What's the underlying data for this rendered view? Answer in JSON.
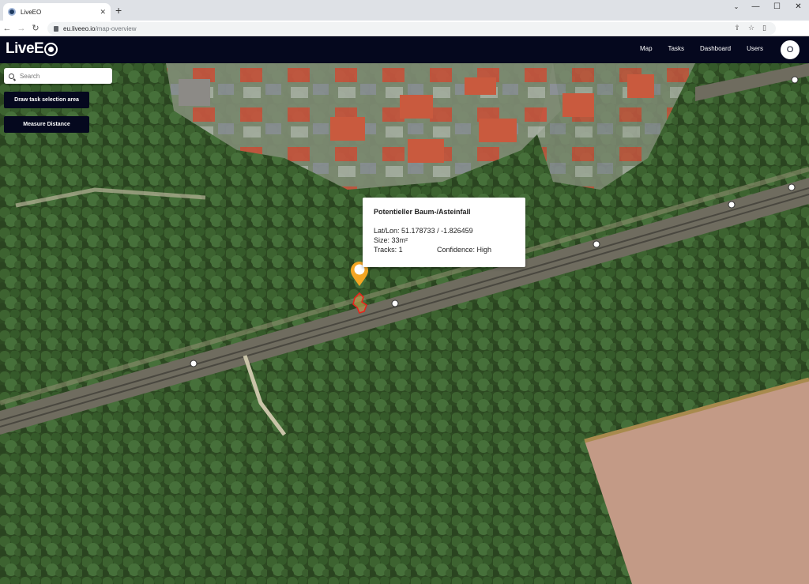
{
  "browser": {
    "tab_title": "LiveEO",
    "tab_close": "✕",
    "new_tab": "+",
    "url_host": "eu.liveeo.io",
    "url_path": "/map-overview",
    "window_controls": [
      "⌄",
      "—",
      "☐",
      "✕"
    ]
  },
  "header": {
    "logo_text": "LiveE",
    "nav": [
      "Map",
      "Tasks",
      "Dashboard",
      "Users"
    ],
    "avatar_initial": "O"
  },
  "map": {
    "search_placeholder": "Search",
    "buttons": {
      "draw_task": "Draw task selection area",
      "measure": "Measure Distance"
    },
    "popup": {
      "title": "Potentieller Baum-/Asteinfall",
      "latlon": "Lat/Lon: 51.178733 / -1.826459",
      "size": "Size: 33m²",
      "tracks": "Tracks: 1",
      "confidence": "Confidence: High"
    },
    "colors": {
      "marker": "#f5a623",
      "detection_outline": "#e8241c",
      "header_bg": "#05081e"
    }
  }
}
